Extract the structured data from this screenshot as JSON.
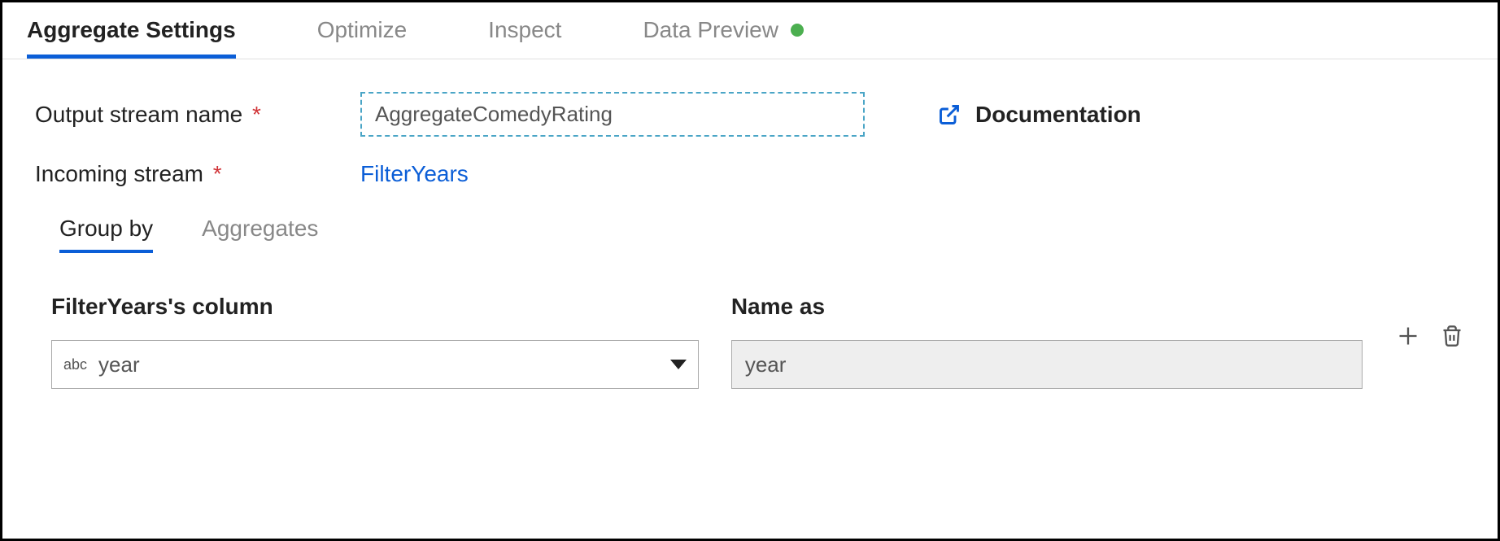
{
  "tabs": {
    "main": [
      {
        "label": "Aggregate Settings",
        "active": true
      },
      {
        "label": "Optimize",
        "active": false
      },
      {
        "label": "Inspect",
        "active": false
      },
      {
        "label": "Data Preview",
        "active": false,
        "status": "green"
      }
    ],
    "sub": [
      {
        "label": "Group by",
        "active": true
      },
      {
        "label": "Aggregates",
        "active": false
      }
    ]
  },
  "form": {
    "output_stream_label": "Output stream name",
    "output_stream_value": "AggregateComedyRating",
    "incoming_stream_label": "Incoming stream",
    "incoming_stream_value": "FilterYears",
    "documentation_label": "Documentation"
  },
  "columns": {
    "left_header": "FilterYears's column",
    "right_header": "Name as",
    "type_prefix": "abc",
    "column_value": "year",
    "name_value": "year"
  }
}
